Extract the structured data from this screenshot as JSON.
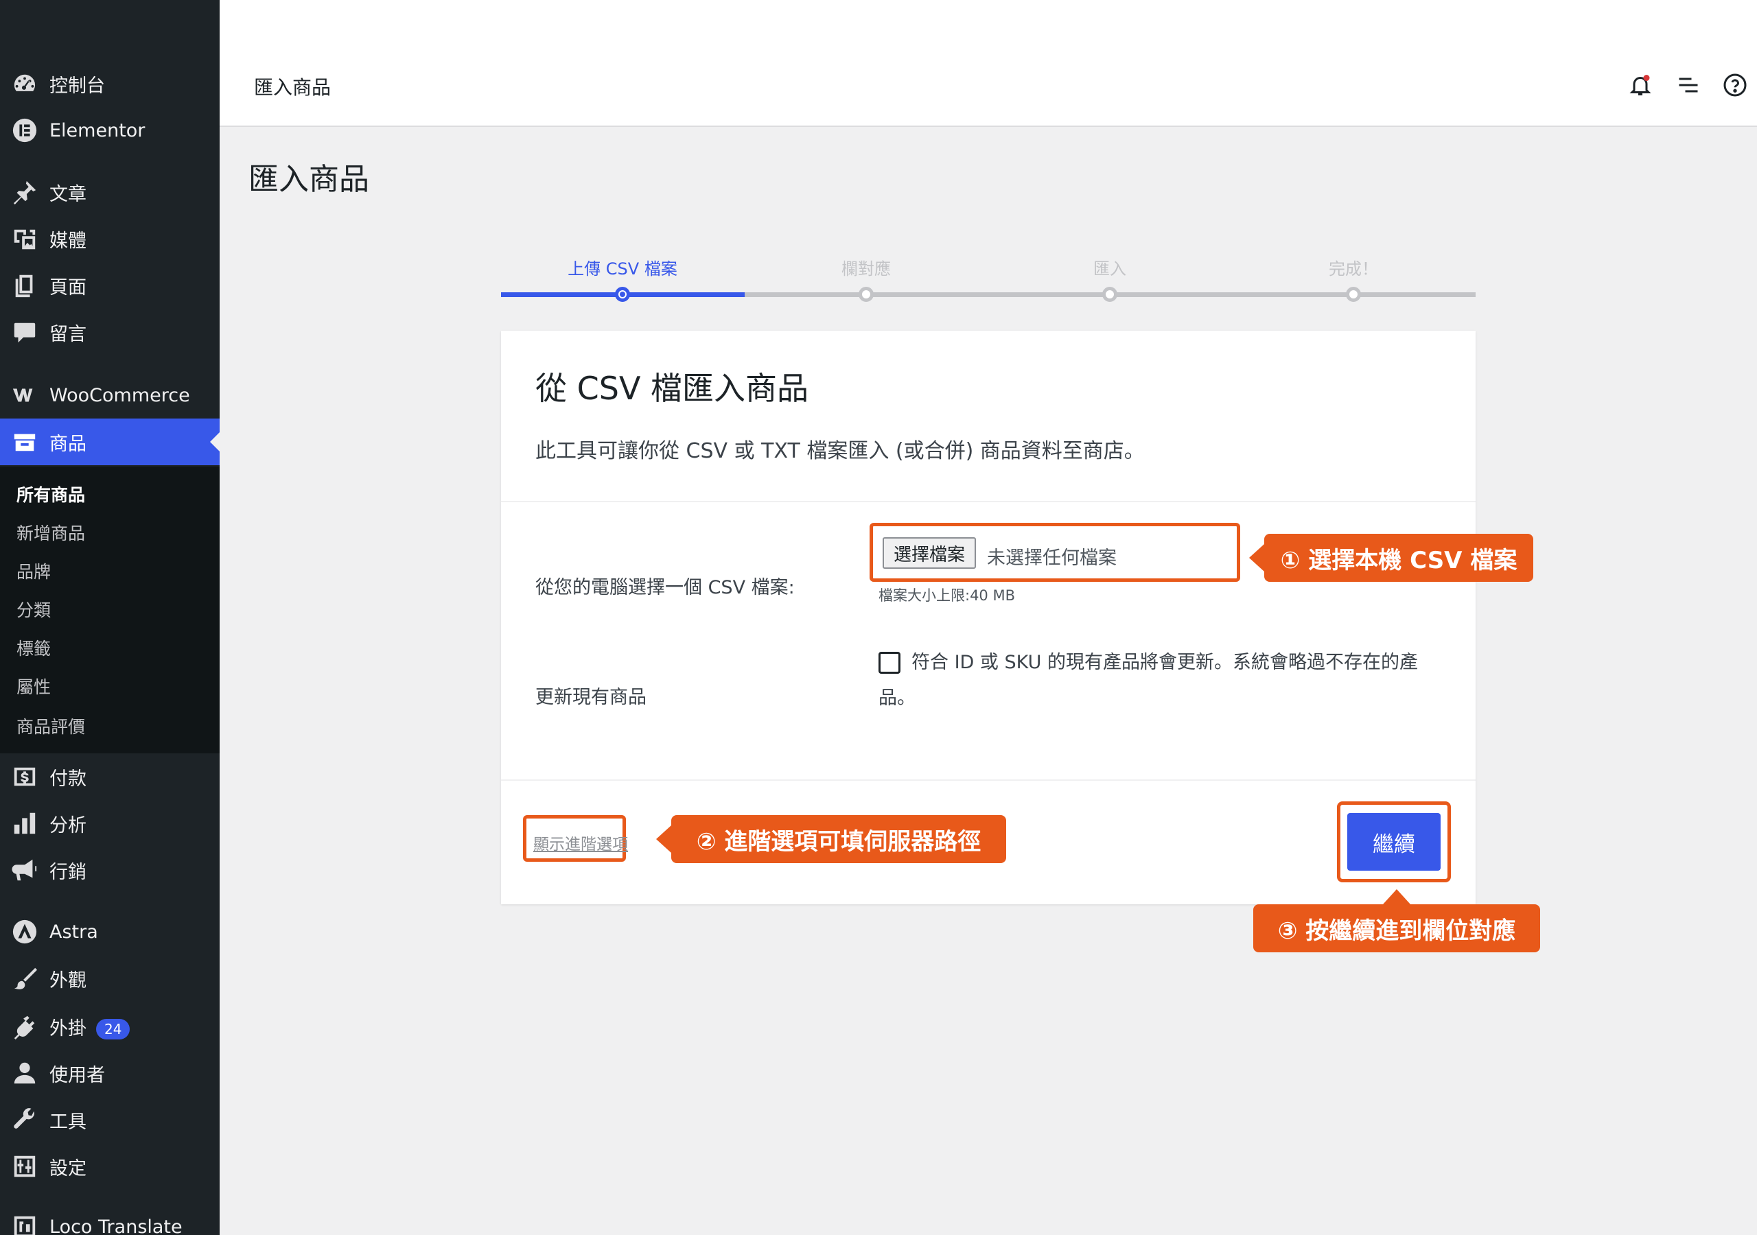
{
  "sidebar": {
    "items": [
      {
        "label": "控制台",
        "icon": "dashboard-icon"
      },
      {
        "label": "Elementor",
        "icon": "elementor-icon"
      },
      {
        "label": "文章",
        "icon": "pin-icon"
      },
      {
        "label": "媒體",
        "icon": "media-icon"
      },
      {
        "label": "頁面",
        "icon": "pages-icon"
      },
      {
        "label": "留言",
        "icon": "comment-icon"
      },
      {
        "label": "WooCommerce",
        "icon": "woocommerce-icon"
      },
      {
        "label": "商品",
        "icon": "archive-icon"
      },
      {
        "label": "付款",
        "icon": "dollar-icon"
      },
      {
        "label": "分析",
        "icon": "bar-chart-icon"
      },
      {
        "label": "行銷",
        "icon": "megaphone-icon"
      },
      {
        "label": "Astra",
        "icon": "astra-icon"
      },
      {
        "label": "外觀",
        "icon": "brush-icon"
      },
      {
        "label": "外掛",
        "icon": "plugin-icon",
        "badge": "24"
      },
      {
        "label": "使用者",
        "icon": "user-icon"
      },
      {
        "label": "工具",
        "icon": "wrench-icon"
      },
      {
        "label": "設定",
        "icon": "settings-icon"
      },
      {
        "label": "Loco Translate",
        "icon": "loco-icon"
      }
    ],
    "submenu": [
      "所有商品",
      "新增商品",
      "品牌",
      "分類",
      "標籤",
      "屬性",
      "商品評價"
    ]
  },
  "header": {
    "breadcrumb": "匯入商品",
    "icons": [
      "notification-icon",
      "menu-lines-icon",
      "help-icon"
    ]
  },
  "page_title": "匯入商品",
  "stepper": {
    "steps": [
      "上傳 CSV 檔案",
      "欄對應",
      "匯入",
      "完成！"
    ],
    "active_index": 0,
    "progress": 0.25
  },
  "card": {
    "title": "從 CSV 檔匯入商品",
    "description": "此工具可讓你從 CSV 或 TXT 檔案匯入 (或合併) 商品資料至商店。",
    "file_label": "從您的電腦選擇一個 CSV 檔案:",
    "file_button": "選擇檔案",
    "file_status": "未選擇任何檔案",
    "file_limit": "檔案大小上限:40 MB",
    "update_label": "更新現有商品",
    "update_desc": "符合 ID 或 SKU 的現有產品將會更新。系統會略過不存在的產品。",
    "update_checked": false,
    "advanced_link": "顯示進階選項",
    "continue_button": "繼續"
  },
  "callouts": {
    "one": "① 選擇本機 CSV 檔案",
    "two": "② 進階選項可填伺服器路徑",
    "three": "③ 按繼續進到欄位對應"
  },
  "colors": {
    "sidebar_bg": "#1d2327",
    "accent": "#3858e9",
    "callout": "#e8591a"
  }
}
